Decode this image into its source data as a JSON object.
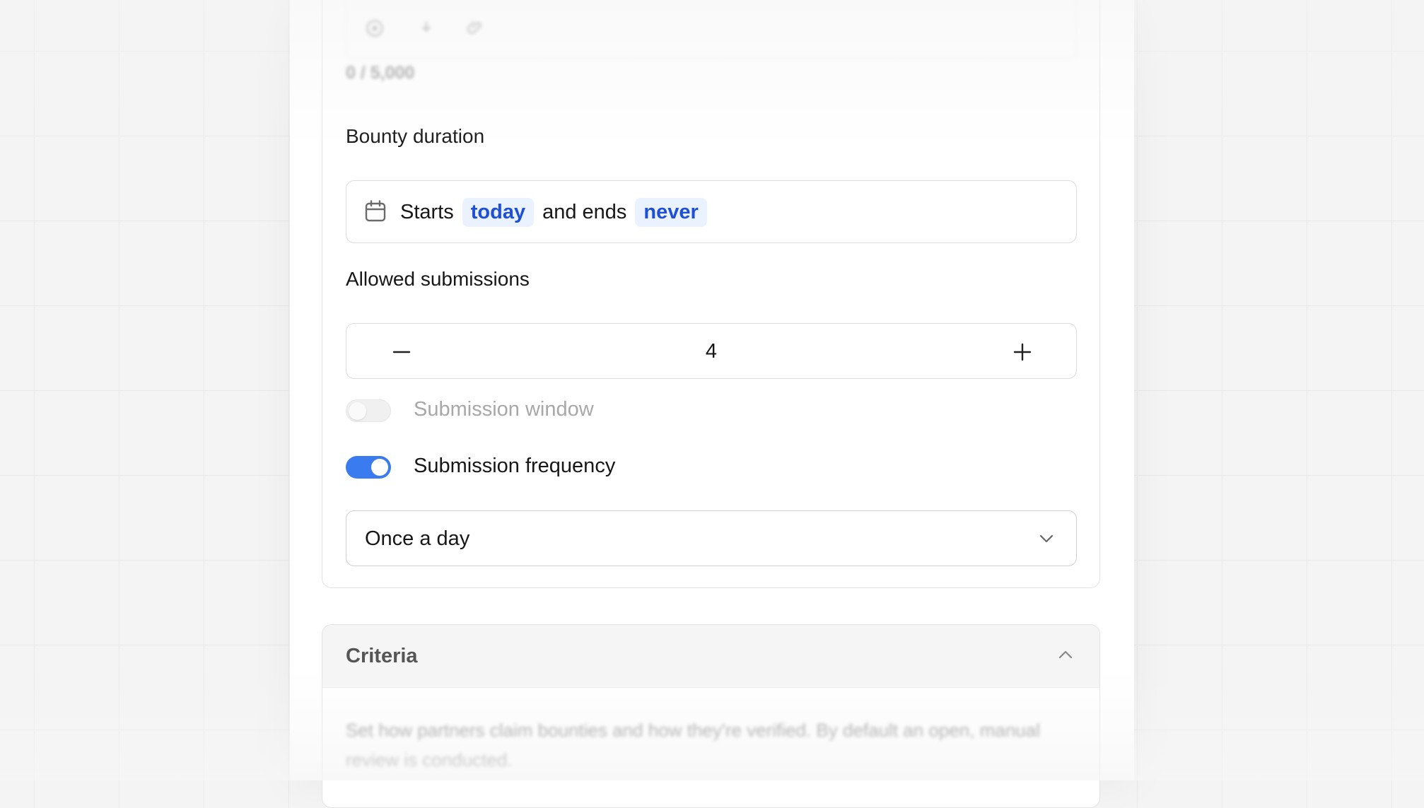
{
  "editor": {
    "toolbar": {
      "icons": [
        "image-icon",
        "download-icon",
        "paperclip-icon"
      ]
    },
    "char_count": "0 / 5,000"
  },
  "bounty_duration": {
    "label": "Bounty duration",
    "prefix": "Starts",
    "start_value": "today",
    "middle": "and ends",
    "end_value": "never",
    "icon": "calendar-icon"
  },
  "allowed_submissions": {
    "label": "Allowed submissions",
    "value": "4",
    "decrement_icon": "minus-icon",
    "increment_icon": "plus-icon"
  },
  "submission_window": {
    "label": "Submission window",
    "enabled": false
  },
  "submission_frequency": {
    "label": "Submission frequency",
    "enabled": true,
    "selected": "Once a day"
  },
  "criteria": {
    "title": "Criteria",
    "description": "Set how partners claim bounties and how they're verified. By default an open, manual review is conducted."
  },
  "colors": {
    "accent": "#3b7bf0",
    "chip_text": "#1e50d6",
    "chip_bg": "#eaf1ff"
  }
}
